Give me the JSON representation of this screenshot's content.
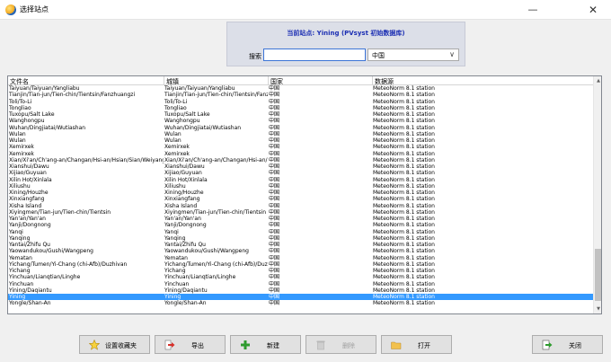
{
  "window": {
    "title": "选择站点"
  },
  "current_station": "当前站点: Yining (PVsyst 初始数据库)",
  "search": {
    "label": "搜索",
    "value": ""
  },
  "country_select": {
    "value": "中国"
  },
  "table": {
    "columns": [
      "文件名",
      "城镇",
      "国家",
      "数据源"
    ],
    "rows": [
      [
        "Taiyuan/Taiyuan/Yangliabu",
        "Taiyuan/Taiyuan/Yangliabu",
        "中国",
        "MeteoNorm 8.1 station"
      ],
      [
        "Tianjin/Tian-jun/Tien-chin/Tientsin/Fanzhuangzi",
        "Tianjin/Tian-jun/Tien-chin/Tientsin/Fanzh",
        "中国",
        "MeteoNorm 8.1 station"
      ],
      [
        "Toli/To-Li",
        "Toli/To-Li",
        "中国",
        "MeteoNorm 8.1 station"
      ],
      [
        "Tongliao",
        "Tongliao",
        "中国",
        "MeteoNorm 8.1 station"
      ],
      [
        "Tuxopu/Salt Lake",
        "Tuxopu/Salt Lake",
        "中国",
        "MeteoNorm 8.1 station"
      ],
      [
        "Wanghongpu",
        "Wanghongpu",
        "中国",
        "MeteoNorm 8.1 station"
      ],
      [
        "Wuhan/Dingjiatai/Wutiashan",
        "Wuhan/Dingjiatai/Wutiashan",
        "中国",
        "MeteoNorm 8.1 station"
      ],
      [
        "Wulan",
        "Wulan",
        "中国",
        "MeteoNorm 8.1 station"
      ],
      [
        "Wulan",
        "Wulan",
        "中国",
        "MeteoNorm 8.1 station"
      ],
      [
        "Xemirxek",
        "Xemirxek",
        "中国",
        "MeteoNorm 8.1 station"
      ],
      [
        "Xemirxek",
        "Xemirxek",
        "中国",
        "MeteoNorm 8.1 station"
      ],
      [
        "Xian/Xi'an/Ch'ang-an/Changan/Hsi-an/Hsian/Sian/Weiyang",
        "Xian/Xi'an/Ch'ang-an/Changan/Hsi-an/Hsi",
        "中国",
        "MeteoNorm 8.1 station"
      ],
      [
        "Xianshui/Dawu",
        "Xianshui/Dawu",
        "中国",
        "MeteoNorm 8.1 station"
      ],
      [
        "Xijiao/Guyuan",
        "Xijiao/Guyuan",
        "中国",
        "MeteoNorm 8.1 station"
      ],
      [
        "Xilin Hot/Xinlala",
        "Xilin Hot/Xinlala",
        "中国",
        "MeteoNorm 8.1 station"
      ],
      [
        "Xiliushu",
        "Xiliushu",
        "中国",
        "MeteoNorm 8.1 station"
      ],
      [
        "Xining/Houzhe",
        "Xining/Houzhe",
        "中国",
        "MeteoNorm 8.1 station"
      ],
      [
        "Xinxiangfang",
        "Xinxiangfang",
        "中国",
        "MeteoNorm 8.1 station"
      ],
      [
        "Xisha Island",
        "Xisha Island",
        "中国",
        "MeteoNorm 8.1 station"
      ],
      [
        "Xiyingmen/Tian-jun/Tien-chin/Tientsin",
        "Xiyingmen/Tian-jun/Tien-chin/Tientsin",
        "中国",
        "MeteoNorm 8.1 station"
      ],
      [
        "Yan'an/Yan'an",
        "Yan'an/Yan'an",
        "中国",
        "MeteoNorm 8.1 station"
      ],
      [
        "Yanji/Dongnong",
        "Yanji/Dongnong",
        "中国",
        "MeteoNorm 8.1 station"
      ],
      [
        "Yanqi",
        "Yanqi",
        "中国",
        "MeteoNorm 8.1 station"
      ],
      [
        "Yanqing",
        "Yanqing",
        "中国",
        "MeteoNorm 8.1 station"
      ],
      [
        "Yantai/Zhifu Qu",
        "Yantai/Zhifu Qu",
        "中国",
        "MeteoNorm 8.1 station"
      ],
      [
        "Yaowandukou/Gushi/Wangpeng",
        "Yaowandukou/Gushi/Wangpeng",
        "中国",
        "MeteoNorm 8.1 station"
      ],
      [
        "Yematan",
        "Yematan",
        "中国",
        "MeteoNorm 8.1 station"
      ],
      [
        "Yichang/Tumen/Yi-Chang (chi-Afb)/Duzhivan",
        "Yichang/Tumen/Yi-Chang (chi-Afb)/Duzhi",
        "中国",
        "MeteoNorm 8.1 station"
      ],
      [
        "Yichang",
        "Yichang",
        "中国",
        "MeteoNorm 8.1 station"
      ],
      [
        "Yinchuan/Lianqtian/Linghe",
        "Yinchuan/Lianqtian/Linghe",
        "中国",
        "MeteoNorm 8.1 station"
      ],
      [
        "Yinchuan",
        "Yinchuan",
        "中国",
        "MeteoNorm 8.1 station"
      ],
      [
        "Yining/Daqiantu",
        "Yining/Daqiantu",
        "中国",
        "MeteoNorm 8.1 station"
      ],
      [
        "Yining",
        "Yining",
        "中国",
        "MeteoNorm 8.1 station"
      ],
      [
        "Yongle/Shan-An",
        "Yongle/Shan-An",
        "中国",
        "MeteoNorm 8.1 station"
      ]
    ],
    "selected_row": 32
  },
  "buttons": {
    "favorites": "设置收藏夹",
    "export": "导出",
    "new": "新建",
    "delete": "删除",
    "open": "打开",
    "close": "关闭"
  },
  "colors": {
    "selection": "#3399ff",
    "current_station_text": "#1c2fb3",
    "header_panel": "#dcdfe8"
  },
  "icons": {
    "favorites": "star-icon",
    "export": "export-arrow-icon",
    "new": "plus-icon",
    "delete": "trash-icon",
    "open": "folder-icon",
    "close": "exit-door-icon"
  }
}
